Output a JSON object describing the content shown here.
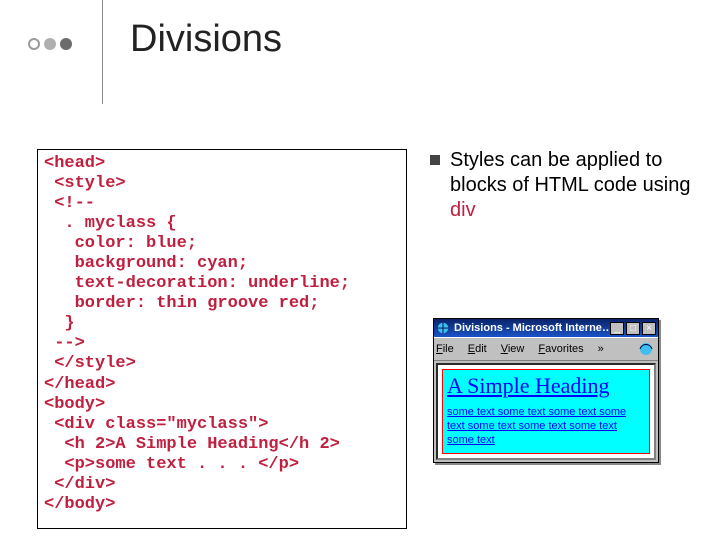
{
  "title": "Divisions",
  "code": "<head>\n <style>\n <!--\n  . myclass {\n   color: blue;\n   background: cyan;\n   text-decoration: underline;\n   border: thin groove red;\n  }\n -->\n </style>\n</head>\n<body>\n <div class=\"myclass\">\n  <h 2>A Simple Heading</h 2>\n  <p>some text . . . </p>\n </div>\n</body>",
  "desc": {
    "text_before_kw": "Styles can be applied to blocks of HTML code using ",
    "kw": "div"
  },
  "browser": {
    "title": "Divisions - Microsoft Interne…",
    "menus": {
      "file": "File",
      "edit": "Edit",
      "view": "View",
      "favorites": "Favorites",
      "more": "»"
    },
    "heading": "A Simple Heading",
    "body": "some text some text some text some text some text some text some text some text"
  }
}
